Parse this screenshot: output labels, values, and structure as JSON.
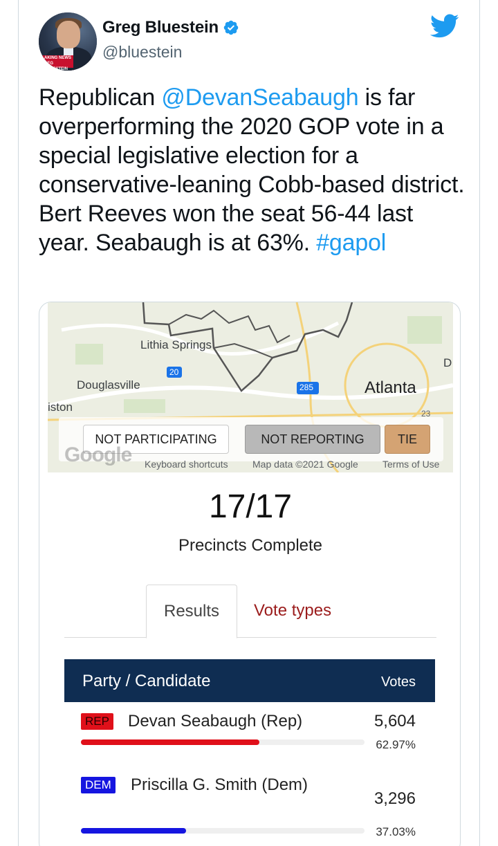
{
  "tweet": {
    "author": {
      "display_name": "Greg Bluestein",
      "handle": "@bluestein",
      "avatar_ticker": "AKING NEWS\nREG BLUESTEIN"
    },
    "text_parts": {
      "p1": "Republican ",
      "mention": "@DevanSeabaugh",
      "p2": " is far overperforming the 2020 GOP vote in a special legislative election for a conservative-leaning Cobb-based district. Bert Reeves won the seat 56-44 last year. Seabaugh is at 63%. ",
      "hashtag": "#gapol"
    },
    "icons": {
      "verified": "verified-badge-icon",
      "brand": "twitter-bird-icon"
    },
    "colors": {
      "link": "#1d9bf0",
      "verified": "#1d9bf0"
    }
  },
  "media": {
    "map": {
      "labels": {
        "lithia": "Lithia Springs",
        "douglasville": "Douglasville",
        "atlanta": "Atlanta",
        "iston": "iston",
        "d": "D",
        "i20": "20",
        "i285": "285",
        "us23": "23"
      },
      "legend": {
        "not_participating": "NOT PARTICIPATING",
        "not_reporting": "NOT REPORTING",
        "tie": "TIE"
      },
      "footer": {
        "logo": "Google",
        "shortcuts": "Keyboard shortcuts",
        "mapdata": "Map data ©2021 Google",
        "terms": "Terms of Use"
      }
    },
    "precincts": {
      "count": "17/17",
      "label": "Precincts Complete"
    },
    "tabs": {
      "results": "Results",
      "vote_types": "Vote types"
    },
    "table": {
      "header": {
        "candidate": "Party / Candidate",
        "votes": "Votes"
      },
      "rows": [
        {
          "party": "REP",
          "name": "Devan Seabaugh (Rep)",
          "votes": "5,604",
          "pct": "62.97%",
          "share": 0.6297,
          "color": "#e0101a"
        },
        {
          "party": "DEM",
          "name": "Priscilla G. Smith (Dem)",
          "votes": "3,296",
          "pct": "37.03%",
          "share": 0.3703,
          "color": "#1515e0"
        }
      ]
    }
  }
}
